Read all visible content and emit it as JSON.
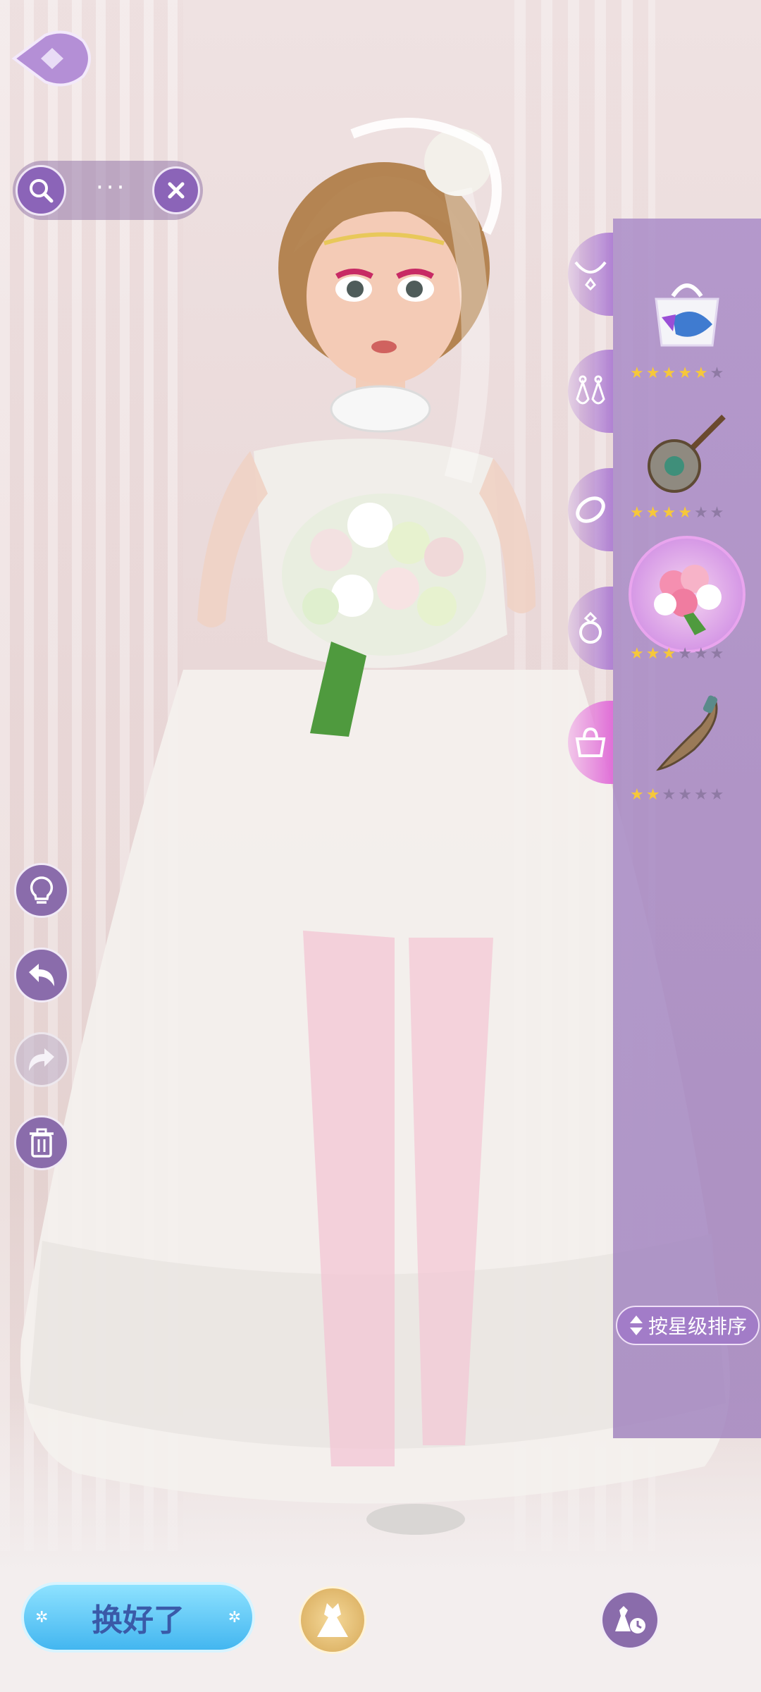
{
  "search": {
    "dots": "···"
  },
  "sort": {
    "label": "按星级排序"
  },
  "footer": {
    "done_label": "换好了"
  },
  "categories": [
    {
      "name": "necklace-icon",
      "active": false
    },
    {
      "name": "earrings-icon",
      "active": false
    },
    {
      "name": "bracelet-icon",
      "active": false
    },
    {
      "name": "ring-icon",
      "active": false
    },
    {
      "name": "handheld-icon",
      "active": true
    }
  ],
  "items": [
    {
      "name": "handbag-item",
      "rating": 5,
      "max": 6,
      "selected": false
    },
    {
      "name": "lute-item",
      "rating": 4,
      "max": 6,
      "selected": false
    },
    {
      "name": "bouquet-item",
      "rating": 3,
      "max": 6,
      "selected": true
    },
    {
      "name": "dagger-item",
      "rating": 2,
      "max": 6,
      "selected": false
    }
  ],
  "colors": {
    "accent": "#8a6cab",
    "panel": "#a88cc6",
    "done": "#43b6f0",
    "star": "#f6c83a"
  }
}
